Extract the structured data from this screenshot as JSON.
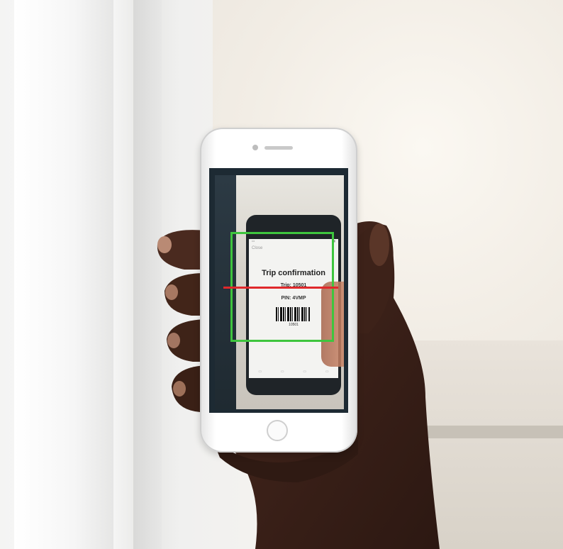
{
  "scene": {
    "description_free": true
  },
  "scanned_document": {
    "nav_label": "Close",
    "title": "Trip confirmation",
    "trip_line": "Trip: 10501",
    "pin_line": "PIN: 4VMP",
    "barcode_number": "10501"
  },
  "colors": {
    "scan_frame": "#3ec53e",
    "scan_line": "#e0282b"
  }
}
